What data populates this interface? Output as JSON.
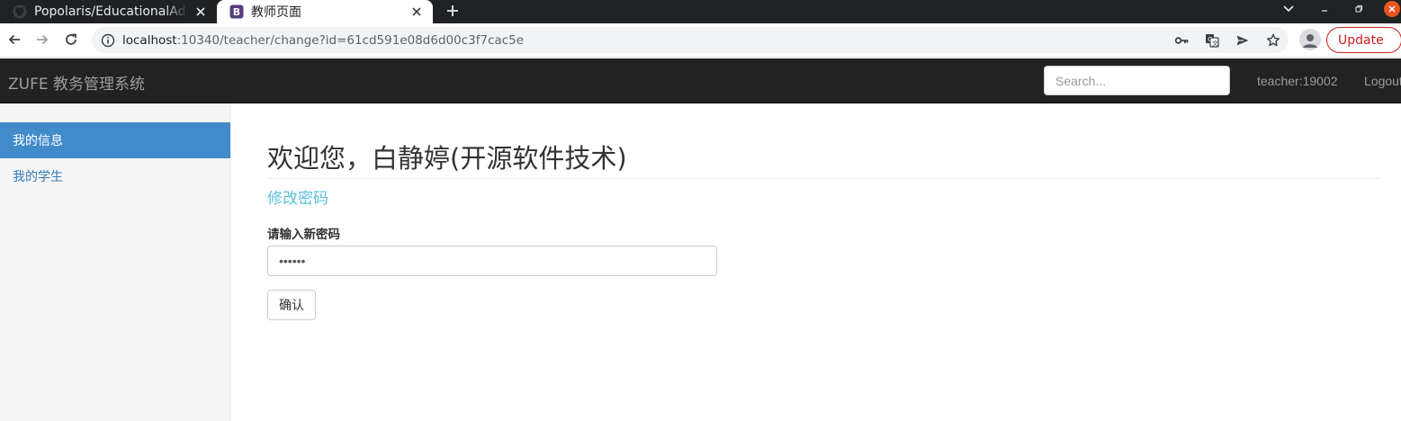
{
  "browser": {
    "tabs": [
      {
        "title": "Popolaris/EducationalAdmin",
        "favicon": "github-icon",
        "active": false
      },
      {
        "title": "教师页面",
        "favicon": "bootstrap-icon",
        "active": true
      }
    ],
    "address": {
      "host": "localhost",
      "path": ":10340/teacher/change?id=61cd591e08d6d00c3f7cac5e"
    },
    "update_label": "Update",
    "colors": {
      "tabstrip": "#202124",
      "update": "#c5221f",
      "bootstrap": "#563d7c"
    }
  },
  "navbar": {
    "brand": "ZUFE 教务管理系统",
    "search_placeholder": "Search...",
    "user": "teacher:19002",
    "logout": "Logout",
    "colors": {
      "background": "#222222",
      "text": "#9d9d9d"
    }
  },
  "sidebar": {
    "items": [
      {
        "label": "我的信息",
        "active": true
      },
      {
        "label": "我的学生",
        "active": false
      }
    ],
    "colors": {
      "active_bg": "#428bca",
      "link": "#337ab7"
    }
  },
  "main": {
    "title": "欢迎您，白静婷(开源软件技术)",
    "subheader": "修改密码",
    "field_label": "请输入新密码",
    "password_value": "123456",
    "confirm_label": "确认",
    "colors": {
      "subheader": "#5bc0de"
    }
  }
}
